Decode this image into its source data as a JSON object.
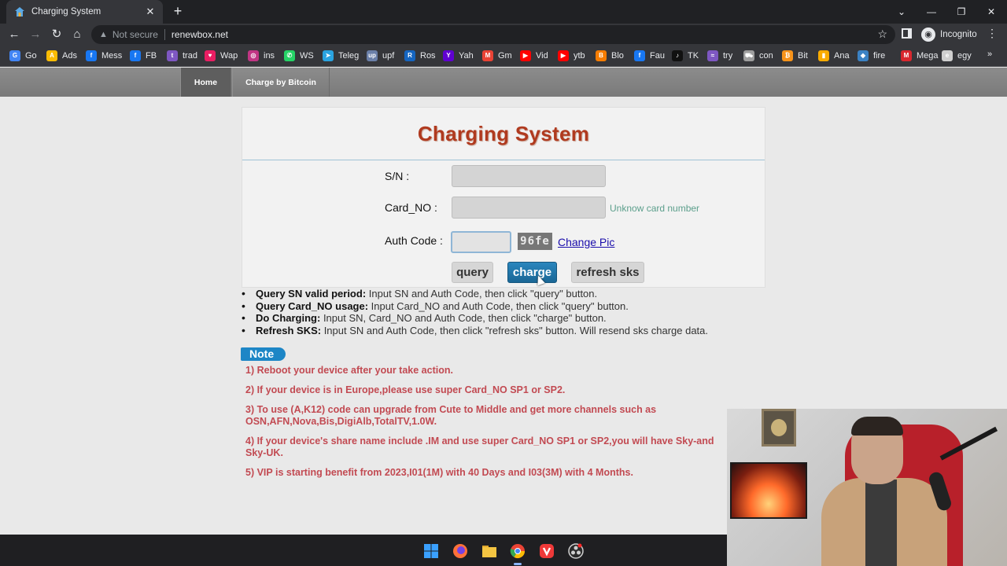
{
  "browser": {
    "tab_title": "Charging System",
    "tab_close": "✕",
    "new_tab": "+",
    "security_label": "Not secure",
    "url": "renewbox.net",
    "incognito_label": "Incognito",
    "window_controls": [
      "⌄",
      "—",
      "❐",
      "✕"
    ]
  },
  "bookmarks": [
    {
      "label": "Go",
      "icon": "google-icon",
      "color": "#4285f4",
      "glyph": "G"
    },
    {
      "label": "Ads",
      "icon": "google-ads-icon",
      "color": "#fbbc04",
      "glyph": "A"
    },
    {
      "label": "Mess",
      "icon": "facebook-icon",
      "color": "#1877f2",
      "glyph": "f"
    },
    {
      "label": "FB",
      "icon": "facebook-icon",
      "color": "#1877f2",
      "glyph": "f"
    },
    {
      "label": "trad",
      "icon": "globe-icon",
      "color": "#7e57c2",
      "glyph": "t"
    },
    {
      "label": "Wap",
      "icon": "heart-icon",
      "color": "#e91e63",
      "glyph": "♥"
    },
    {
      "label": "ins",
      "icon": "instagram-icon",
      "color": "#c13584",
      "glyph": "◎"
    },
    {
      "label": "WS",
      "icon": "whatsapp-icon",
      "color": "#25d366",
      "glyph": "✆"
    },
    {
      "label": "Teleg",
      "icon": "telegram-icon",
      "color": "#2aa3e0",
      "glyph": "➤"
    },
    {
      "label": "upf",
      "icon": "upf-icon",
      "color": "#6a7fa8",
      "glyph": "up"
    },
    {
      "label": "Ros",
      "icon": "rosetta-icon",
      "color": "#1565c0",
      "glyph": "R"
    },
    {
      "label": "Yah",
      "icon": "yahoo-icon",
      "color": "#6001d2",
      "glyph": "Y"
    },
    {
      "label": "Gm",
      "icon": "gmail-icon",
      "color": "#ea4335",
      "glyph": "M"
    },
    {
      "label": "Vid",
      "icon": "youtube-icon",
      "color": "#ff0000",
      "glyph": "▶"
    },
    {
      "label": "ytb",
      "icon": "youtube-icon",
      "color": "#ff0000",
      "glyph": "▶"
    },
    {
      "label": "Blo",
      "icon": "blogger-icon",
      "color": "#f57c00",
      "glyph": "B"
    },
    {
      "label": "Fau",
      "icon": "facebook-icon",
      "color": "#1877f2",
      "glyph": "f"
    },
    {
      "label": "TK",
      "icon": "tiktok-icon",
      "color": "#111111",
      "glyph": "♪"
    },
    {
      "label": "try",
      "icon": "wave-icon",
      "color": "#7e57c2",
      "glyph": "≈"
    },
    {
      "label": "con",
      "icon": "car-icon",
      "color": "#9e9e9e",
      "glyph": "⛟"
    },
    {
      "label": "Bit",
      "icon": "bitcoin-icon",
      "color": "#f7931a",
      "glyph": "₿"
    },
    {
      "label": "Ana",
      "icon": "analytics-icon",
      "color": "#f9ab00",
      "glyph": "▮"
    },
    {
      "label": "fire",
      "icon": "firebase-icon",
      "color": "#3b82c4",
      "glyph": "◆"
    },
    {
      "label": "Mega",
      "icon": "mega-icon",
      "color": "#d9272e",
      "glyph": "M"
    },
    {
      "label": "egy",
      "icon": "egy-icon",
      "color": "#cfcfcf",
      "glyph": "e"
    }
  ],
  "bookmarks_more": "»",
  "site_nav": [
    {
      "label": "Home",
      "active": true
    },
    {
      "label": "Charge by Bitcoin",
      "active": false
    }
  ],
  "panel": {
    "title": "Charging System",
    "sn_label": "S/N :",
    "sn_value": "",
    "card_label": "Card_NO :",
    "card_value": "",
    "card_hint": "Unknow card number",
    "auth_label": "Auth Code :",
    "auth_value": "",
    "captcha_text": "96fe",
    "change_pic": "Change Pic",
    "buttons": {
      "query": "query",
      "charge": "charge",
      "refresh": "refresh sks"
    }
  },
  "instructions": [
    {
      "title": "Query SN valid period:",
      "text": " Input SN and Auth Code, then click \"query\" button."
    },
    {
      "title": "Query Card_NO usage:",
      "text": " Input Card_NO and Auth Code, then click \"query\" button."
    },
    {
      "title": "Do Charging:",
      "text": " Input SN, Card_NO and Auth Code, then click \"charge\" button."
    },
    {
      "title": "Refresh SKS:",
      "text": " Input SN and Auth Code, then click \"refresh sks\" button. Will resend sks charge data."
    }
  ],
  "note_label": "Note",
  "notes": [
    "1) Reboot your device after your take action.",
    "2) If your device is in Europe,please use super Card_NO SP1 or SP2.",
    "3) To use (A,K12) code can upgrade from Cute to Middle and get more channels such as OSN,AFN,Nova,Bis,DigiAlb,TotalTV,1.0W.",
    "4) If your device's share name include .IM and use super Card_NO SP1 or SP2,you will have Sky-and Sky-UK.",
    "5) VIP is starting benefit from 2023,I01(1M) with 40 Days and I03(3M) with 4 Months."
  ],
  "taskbar": [
    {
      "icon": "windows-start-icon",
      "color": "#3aa0ff"
    },
    {
      "icon": "firefox-icon",
      "color": "#ff7139"
    },
    {
      "icon": "file-explorer-icon",
      "color": "#f5c542"
    },
    {
      "icon": "chrome-icon",
      "color": "#ea4335"
    },
    {
      "icon": "vivaldi-icon",
      "color": "#ef3939"
    },
    {
      "icon": "obs-icon",
      "color": "#cfcfcf"
    }
  ]
}
